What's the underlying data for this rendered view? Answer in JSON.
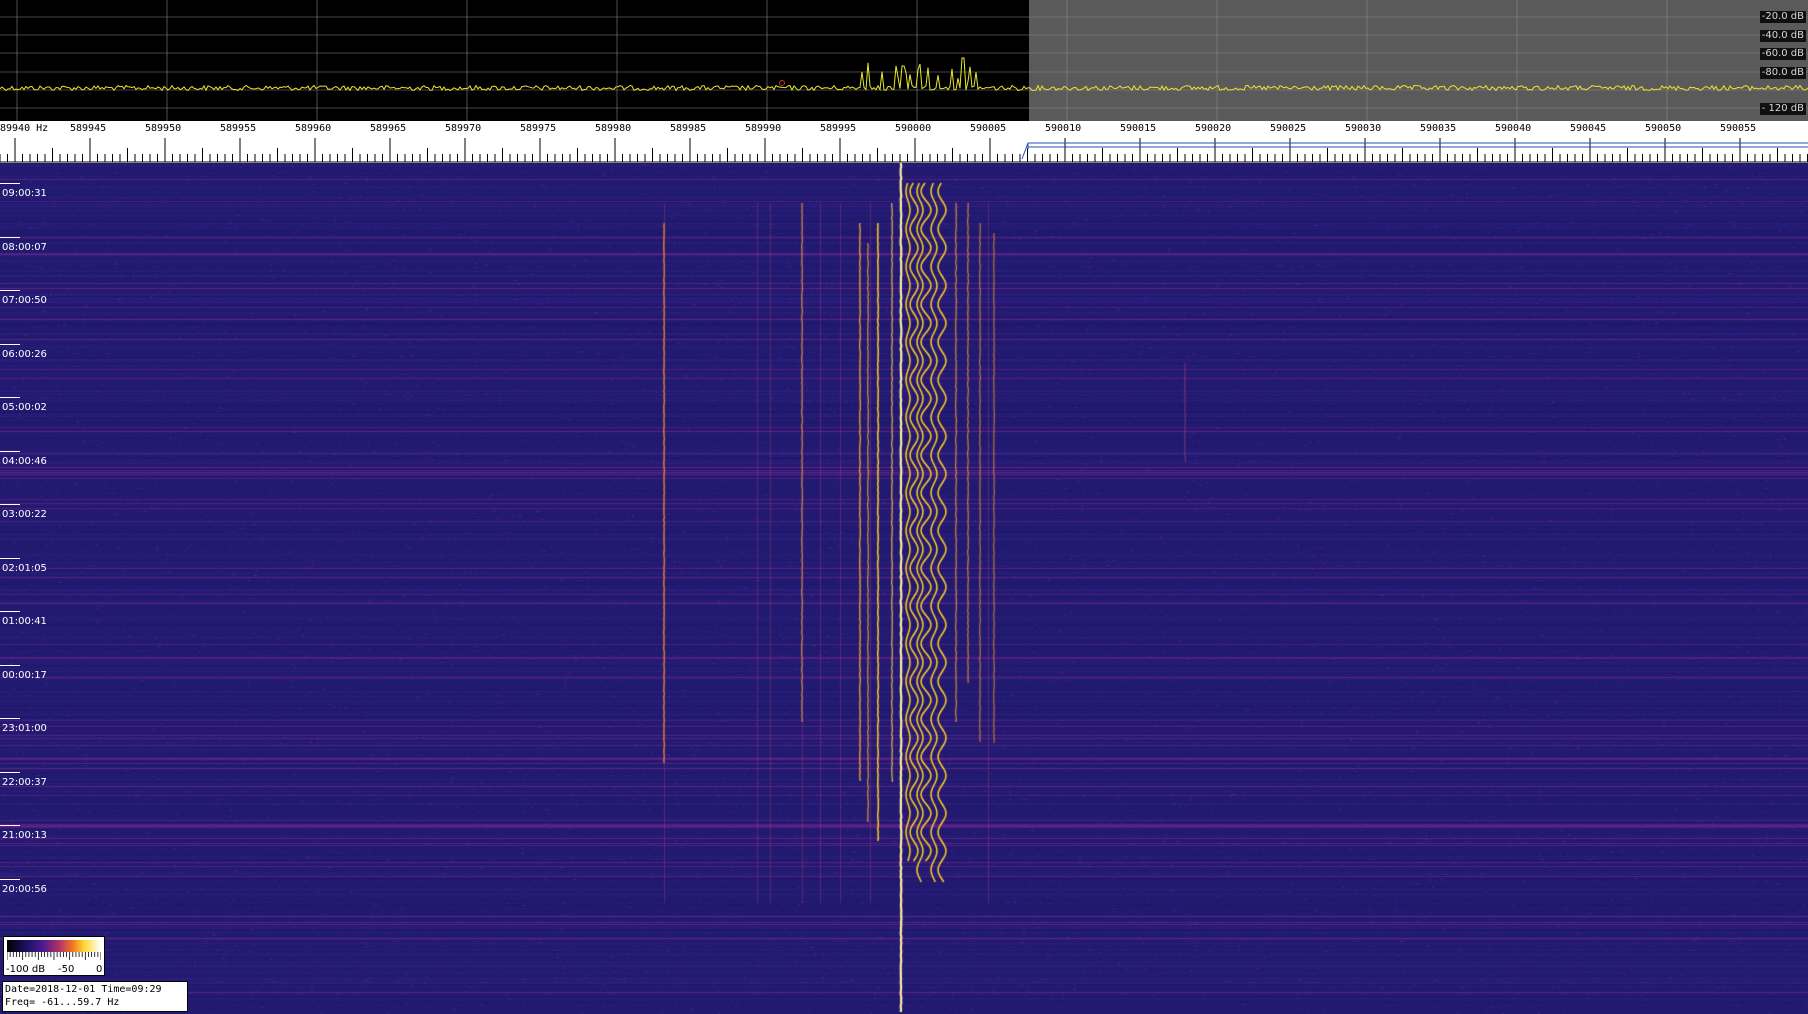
{
  "spectrum": {
    "db_labels": [
      "-20.0 dB",
      "-40.0 dB",
      "-60.0 dB",
      "-80.0 dB",
      "- 120 dB"
    ],
    "trace_color": "#e8e832",
    "grid_color": "#888888",
    "shade_color": "#5a5a5a"
  },
  "ruler": {
    "unit_label": "89940 Hz",
    "freq_labels": [
      "589945",
      "589950",
      "589955",
      "589960",
      "589965",
      "589970",
      "589975",
      "589980",
      "589985",
      "589990",
      "589995",
      "590000",
      "590005",
      "590010",
      "590015",
      "590020",
      "590025",
      "590030",
      "590035",
      "590040",
      "590045",
      "590050",
      "590055"
    ]
  },
  "waterfall": {
    "time_labels": [
      "09:00:31",
      "08:00:07",
      "07:00:50",
      "06:00:26",
      "05:00:02",
      "04:00:46",
      "03:00:22",
      "02:01:05",
      "01:00:41",
      "00:00:17",
      "23:01:00",
      "22:00:37",
      "21:00:13",
      "20:00:56"
    ],
    "background_color": "#221a70",
    "signal_color": "#ffd020"
  },
  "colorbar": {
    "labels": [
      "-100 dB",
      "-50",
      "0"
    ]
  },
  "info": {
    "date_line": "Date=2018-12-01 Time=09:29",
    "freq_line": "Freq= -61...59.7 Hz"
  }
}
